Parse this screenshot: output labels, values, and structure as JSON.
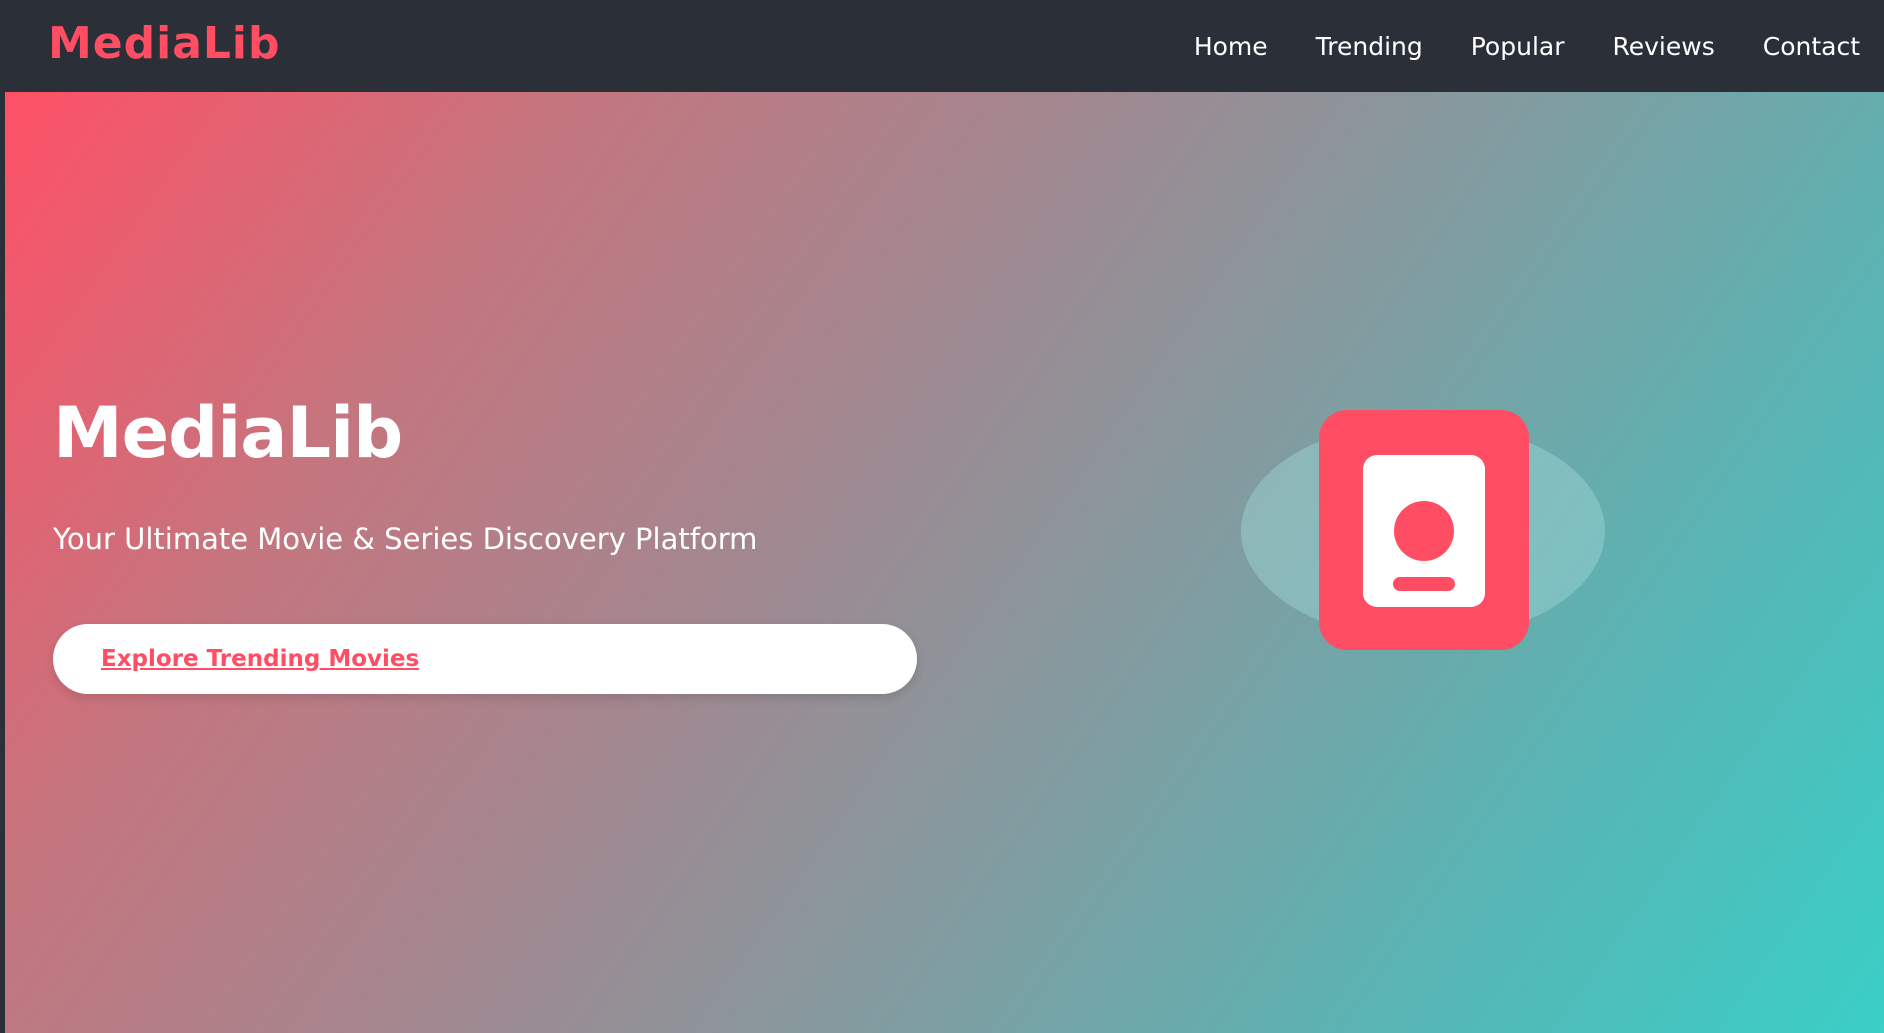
{
  "navbar": {
    "logo": "MediaLib",
    "links": [
      "Home",
      "Trending",
      "Popular",
      "Reviews",
      "Contact"
    ]
  },
  "hero": {
    "title": "MediaLib",
    "subtitle": "Your Ultimate Movie & Series Discovery Platform",
    "cta_label": "Explore Trending Movies"
  },
  "colors": {
    "accent": "#ff4d63",
    "navbar_bg": "#2b2f38",
    "gradient_start": "#ff5066",
    "gradient_end": "#3acfc7",
    "text_light": "#ffffff"
  },
  "icons": {
    "illustration": "contact-card-icon"
  }
}
